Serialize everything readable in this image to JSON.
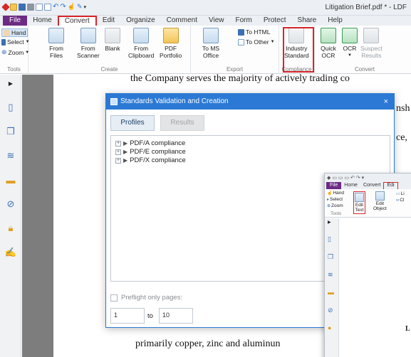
{
  "window": {
    "title": "Litigation Brief.pdf * - LDF"
  },
  "tabs": [
    "File",
    "Home",
    "Convert",
    "Edit",
    "Organize",
    "Comment",
    "View",
    "Form",
    "Protect",
    "Share",
    "Help"
  ],
  "ribbon": {
    "tools": {
      "hand": "Hand",
      "select": "Select",
      "zoom": "Zoom",
      "label": "Tools"
    },
    "create": {
      "from_files": "From\nFiles",
      "from_scanner": "From\nScanner",
      "blank": "Blank",
      "from_clipboard": "From\nClipboard",
      "pdf_portfolio": "PDF\nPortfolio",
      "label": "Create"
    },
    "export": {
      "to_ms_office": "To MS\nOffice",
      "to_html": "To HTML",
      "to_other": "To Other",
      "label": "Export"
    },
    "compliance": {
      "industry_standard": "Industry\nStandard",
      "label": "Compliance"
    },
    "convert": {
      "quick_ocr": "Quick\nOCR",
      "ocr": "OCR",
      "suspect_results": "Suspect\nResults",
      "label": "Convert"
    }
  },
  "document": {
    "line1": "the Company serves the majority of actively trading co",
    "frag_a": "nsh",
    "frag_b": "ce,",
    "line_bottom": "primarily copper, zinc and aluminun"
  },
  "dialog": {
    "title": "Standards Validation and Creation",
    "close": "×",
    "tab_profiles": "Profiles",
    "tab_results": "Results",
    "tree": [
      "PDF/A compliance",
      "PDF/E compliance",
      "PDF/X compliance"
    ],
    "preflight_label": "Preflight only pages:",
    "from_page": "1",
    "to_label": "to",
    "to_page": "10"
  },
  "inset": {
    "tabs": [
      "File",
      "Home",
      "Convert",
      "Edi"
    ],
    "hand": "Hand",
    "select": "Select",
    "zoom": "Zoom",
    "tools_label": "Tools",
    "edit_text": "Edit\nText",
    "edit_object": "Edit\nObject",
    "li": "Li",
    "cl": "Cl",
    "page_letter": "L"
  },
  "colors": {
    "accent": "#2b79d5",
    "file_tab": "#6c2b84",
    "highlight": "#d6262b",
    "gutter": "#7d7d7d"
  }
}
